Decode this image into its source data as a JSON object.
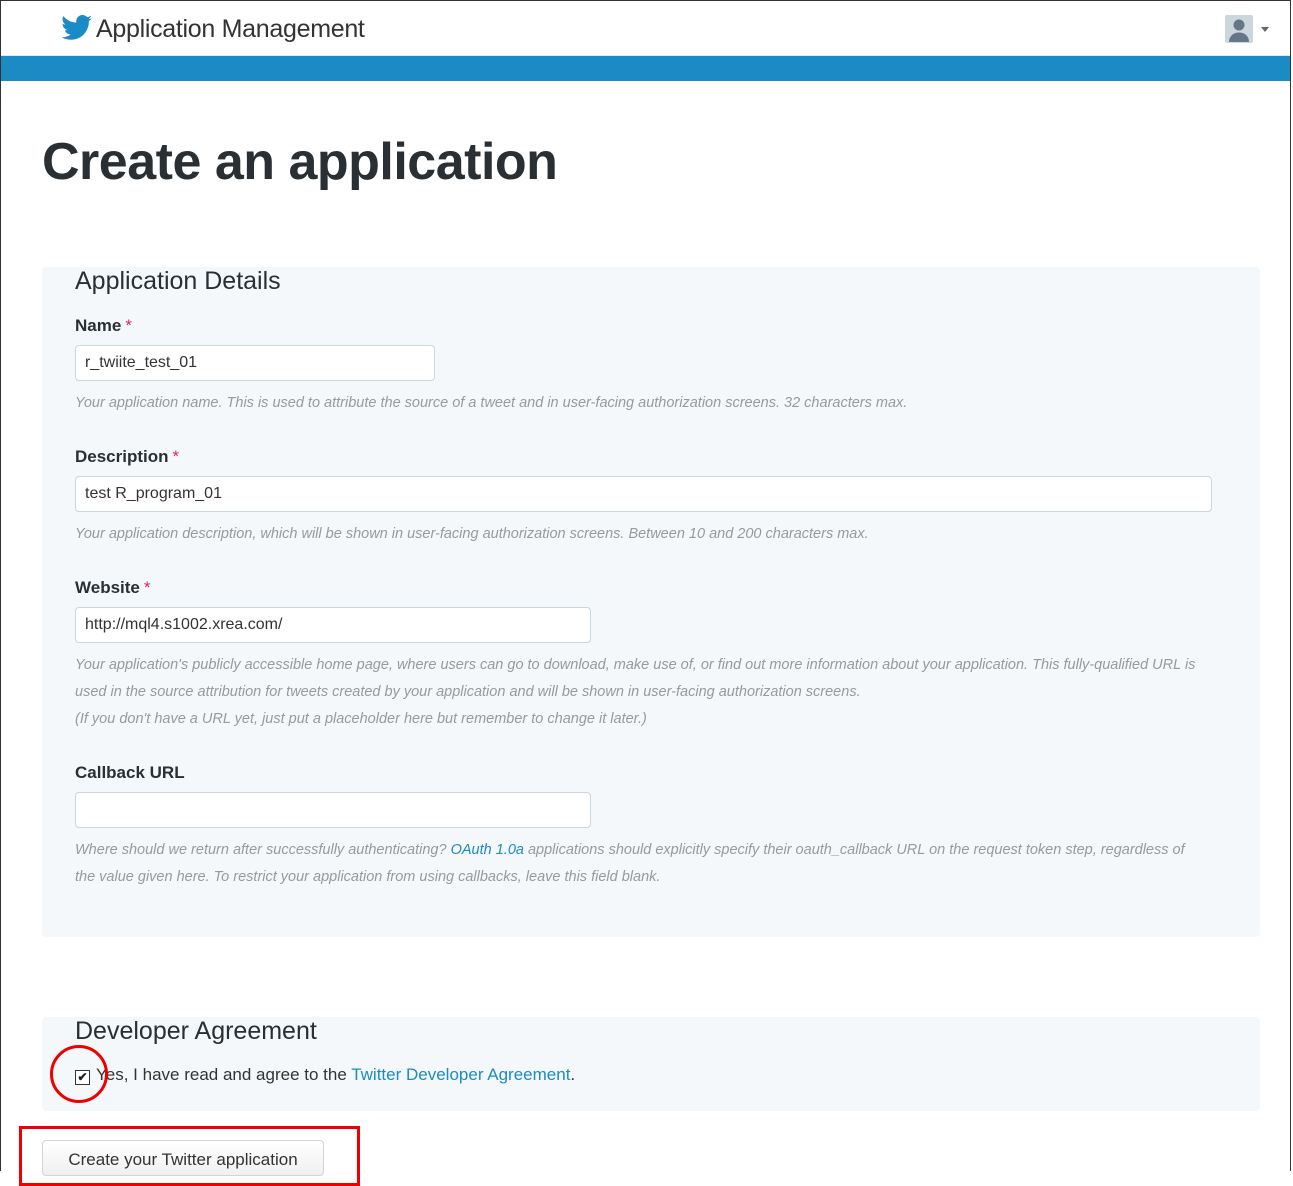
{
  "header": {
    "title": "Application Management"
  },
  "page_title": "Create an application",
  "details": {
    "heading": "Application Details",
    "required_mark": "*",
    "name": {
      "label": "Name",
      "value": "r_twiite_test_01",
      "help": "Your application name. This is used to attribute the source of a tweet and in user-facing authorization screens. 32 characters max."
    },
    "description": {
      "label": "Description",
      "value": "test R_program_01",
      "help": "Your application description, which will be shown in user-facing authorization screens. Between 10 and 200 characters max."
    },
    "website": {
      "label": "Website",
      "value": "http://mql4.s1002.xrea.com/",
      "help_line1": "Your application's publicly accessible home page, where users can go to download, make use of, or find out more information about your application. This fully-qualified URL is used in the source attribution for tweets created by your application and will be shown in user-facing authorization screens.",
      "help_line2": "(If you don't have a URL yet, just put a placeholder here but remember to change it later.)"
    },
    "callback": {
      "label": "Callback URL",
      "value": "",
      "help_before": "Where should we return after successfully authenticating? ",
      "help_link": "OAuth 1.0a",
      "help_after": " applications should explicitly specify their oauth_callback URL on the request token step, regardless of the value given here. To restrict your application from using callbacks, leave this field blank."
    }
  },
  "agreement": {
    "heading": "Developer Agreement",
    "checked": true,
    "check_glyph": "✔",
    "text": "Yes, I have read and agree to the ",
    "link": "Twitter Developer Agreement",
    "after_link": "."
  },
  "submit": {
    "label": "Create your Twitter application"
  },
  "colors": {
    "accent": "#1b8bc6",
    "required": "#e0245e",
    "annotation": "#e00000"
  }
}
